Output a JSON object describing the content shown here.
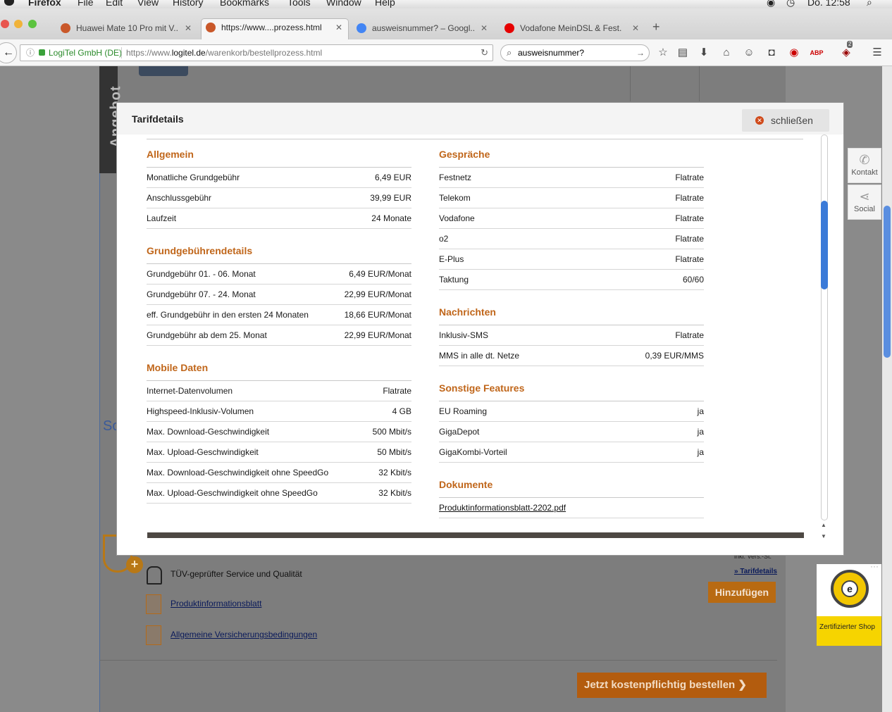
{
  "menubar": {
    "app": "Firefox",
    "items": [
      "File",
      "Edit",
      "View",
      "History",
      "Bookmarks",
      "Tools",
      "Window",
      "Help"
    ],
    "clock": "Do. 12:58"
  },
  "tabs": [
    {
      "label": "Huawei Mate 10 Pro mit V...",
      "favicon_color": "#c9582a"
    },
    {
      "label": "https://www....prozess.html",
      "favicon_color": "#c9582a",
      "active": true
    },
    {
      "label": "ausweisnummer? – Googl...",
      "favicon_color": "#4285f4"
    },
    {
      "label": "Vodafone MeinDSL & Fest...",
      "favicon_color": "#e60000"
    }
  ],
  "navbar": {
    "org": "LogiTel GmbH (DE)",
    "url_prefix": "https://www.",
    "url_domain": "logitel.de",
    "url_path": "/warenkorb/bestellprozess.html",
    "search_value": "ausweisnummer?",
    "badge_count": "2"
  },
  "background": {
    "angebot": "Angebot",
    "so_text": "So",
    "tuv": "TÜV-geprüfter Service und Qualität",
    "link_produktinfo": "Produktinformationsblatt",
    "link_avb": "Allgemeine Versicherungsbedingungen",
    "ink_vers": "inkl. Vers.-St.",
    "tarifdetails_link": "» Tarifdetails",
    "hinzufuegen": "Hinzufügen",
    "order_button": "Jetzt kostenpflichtig bestellen"
  },
  "side": {
    "kontakt": "Kontakt",
    "social": "Social",
    "trusted_text": "Zertifizierter Shop",
    "trusted_seal_letter": "e"
  },
  "modal": {
    "title": "Tarifdetails",
    "close_label": "schließen",
    "left_sections": [
      {
        "title": "Allgemein",
        "rows": [
          {
            "k": "Monatliche Grundgebühr",
            "v": "6,49 EUR"
          },
          {
            "k": "Anschlussgebühr",
            "v": "39,99 EUR"
          },
          {
            "k": "Laufzeit",
            "v": "24 Monate"
          }
        ]
      },
      {
        "title": "Grundgebührendetails",
        "rows": [
          {
            "k": "Grundgebühr 01. - 06. Monat",
            "v": "6,49 EUR/Monat"
          },
          {
            "k": "Grundgebühr 07. - 24. Monat",
            "v": "22,99 EUR/Monat"
          },
          {
            "k": "eff. Grundgebühr in den ersten 24 Monaten",
            "v": "18,66 EUR/Monat"
          },
          {
            "k": "Grundgebühr ab dem 25. Monat",
            "v": "22,99 EUR/Monat"
          }
        ]
      },
      {
        "title": "Mobile Daten",
        "rows": [
          {
            "k": "Internet-Datenvolumen",
            "v": "Flatrate"
          },
          {
            "k": "Highspeed-Inklusiv-Volumen",
            "v": "4 GB"
          },
          {
            "k": "Max. Download-Geschwindigkeit",
            "v": "500 Mbit/s"
          },
          {
            "k": "Max. Upload-Geschwindigkeit",
            "v": "50 Mbit/s"
          },
          {
            "k": "Max. Download-Geschwindigkeit ohne SpeedGo",
            "v": "32 Kbit/s"
          },
          {
            "k": "Max. Upload-Geschwindigkeit ohne SpeedGo",
            "v": "32 Kbit/s"
          }
        ]
      }
    ],
    "right_sections": [
      {
        "title": "Gespräche",
        "rows": [
          {
            "k": "Festnetz",
            "v": "Flatrate"
          },
          {
            "k": "Telekom",
            "v": "Flatrate"
          },
          {
            "k": "Vodafone",
            "v": "Flatrate"
          },
          {
            "k": "o2",
            "v": "Flatrate"
          },
          {
            "k": "E-Plus",
            "v": "Flatrate"
          },
          {
            "k": "Taktung",
            "v": "60/60"
          }
        ]
      },
      {
        "title": "Nachrichten",
        "rows": [
          {
            "k": "Inklusiv-SMS",
            "v": "Flatrate"
          },
          {
            "k": "MMS in alle dt. Netze",
            "v": "0,39 EUR/MMS"
          }
        ]
      },
      {
        "title": "Sonstige Features",
        "rows": [
          {
            "k": "EU Roaming",
            "v": "ja"
          },
          {
            "k": "GigaDepot",
            "v": "ja"
          },
          {
            "k": "GigaKombi-Vorteil",
            "v": "ja"
          }
        ]
      },
      {
        "title": "Dokumente",
        "rows": [
          {
            "k": "Produktinformationsblatt-2202.pdf",
            "v": "",
            "link": true
          }
        ]
      }
    ]
  }
}
